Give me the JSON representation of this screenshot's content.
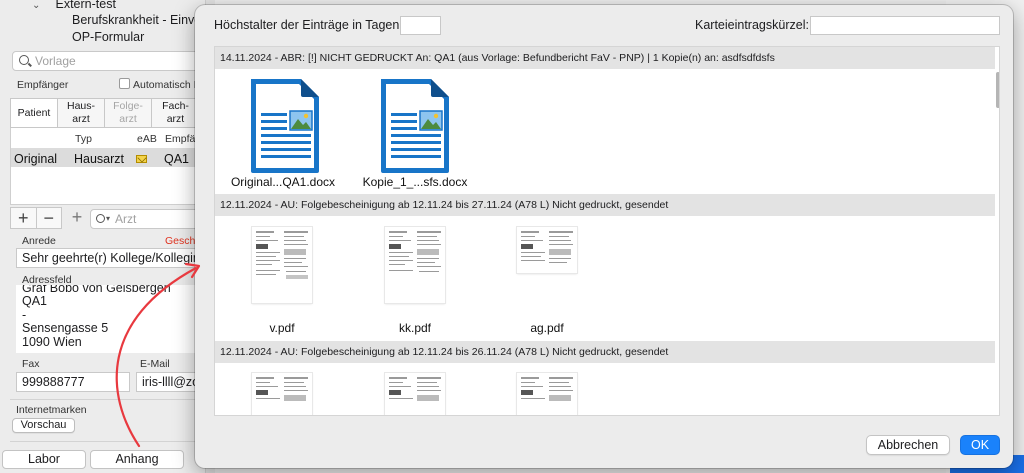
{
  "background": {
    "tree": {
      "root": "Extern-test",
      "children": [
        "Berufskrankheit - Einve",
        "OP-Formular"
      ]
    },
    "template_search": {
      "placeholder": "Vorlage"
    },
    "recipients_label": "Empfänger",
    "auto_label": "Automatisch E",
    "tabs": [
      {
        "label": "Patient",
        "active": true,
        "enabled": true
      },
      {
        "label": "Haus-\narzt",
        "active": false,
        "enabled": true
      },
      {
        "label": "Folge-\narzt",
        "active": false,
        "enabled": false
      },
      {
        "label": "Fach-\narzt",
        "active": false,
        "enabled": true
      }
    ],
    "table": {
      "headers": [
        "Typ",
        "eAB",
        "Empfä"
      ],
      "rows": [
        {
          "col1": "Original",
          "typ": "Hausarzt",
          "eab_icon": "envelope-icon",
          "empf": "QA1"
        }
      ]
    },
    "plus": "+",
    "minus": "−",
    "doctor_search": {
      "placeholder": "Arzt"
    },
    "salutation_label": "Anrede",
    "gender_label": "Gesch",
    "salutation_value": "Sehr geehrte(r) Kollege/Kollegin C",
    "address_label": "Adressfeld",
    "address_lines": [
      "Graf Bobo von Geisbergen",
      "QA1",
      "-",
      "Sensengasse 5",
      "1090 Wien"
    ],
    "fax_label": "Fax",
    "fax_value": "999888777",
    "email_label": "E-Mail",
    "email_value": "iris-llll@zo",
    "stamps_label": "Internetmarken",
    "preview_button": "Vorschau",
    "bottom_buttons": [
      "Labor",
      "Anhang"
    ]
  },
  "dialog": {
    "max_age_label": "Höchstalter der Einträge in Tagen:",
    "max_age_value": "",
    "shortcut_label": "Karteieintragskürzel:",
    "shortcut_value": "",
    "groups": [
      {
        "header": "14.11.2024 - ABR: [!] NICHT GEDRUCKT An:  QA1 (aus Vorlage: Befundbericht FaV - PNP) | 1 Kopie(n) an: asdfsdfdsfs",
        "files": [
          {
            "name": "Original...QA1.docx",
            "kind": "docx"
          },
          {
            "name": "Kopie_1_...sfs.docx",
            "kind": "docx"
          }
        ]
      },
      {
        "header": "12.11.2024 - AU: Folgebescheinigung ab 12.11.24 bis 27.11.24 (A78 L) Nicht gedruckt, gesendet",
        "files": [
          {
            "name": "v.pdf",
            "kind": "pdf"
          },
          {
            "name": "kk.pdf",
            "kind": "pdf"
          },
          {
            "name": "ag.pdf",
            "kind": "pdf"
          }
        ]
      },
      {
        "header": "12.11.2024 - AU: Folgebescheinigung ab 12.11.24 bis 26.11.24 (A78 L) Nicht gedruckt, gesendet",
        "files": [
          {
            "name": "",
            "kind": "pdf"
          },
          {
            "name": "",
            "kind": "pdf"
          },
          {
            "name": "",
            "kind": "pdf"
          }
        ]
      }
    ],
    "cancel_button": "Abbrechen",
    "ok_button": "OK"
  },
  "colors": {
    "accent": "#1a82fb",
    "annotation_arrow": "#e8393f",
    "doc_icon_blue": "#1875c8"
  }
}
